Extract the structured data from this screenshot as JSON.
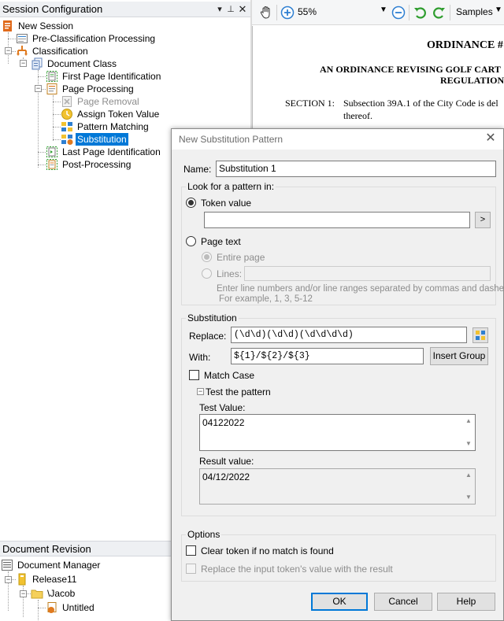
{
  "session_panel": {
    "title": "Session Configuration",
    "tree": [
      {
        "label": "New Session"
      },
      {
        "label": "Pre-Classification Processing"
      },
      {
        "label": "Classification"
      },
      {
        "label": "Document Class"
      },
      {
        "label": "First Page Identification"
      },
      {
        "label": "Page Processing"
      },
      {
        "label": "Page Removal",
        "disabled": true
      },
      {
        "label": "Assign Token Value"
      },
      {
        "label": "Pattern Matching"
      },
      {
        "label": "Substitution",
        "selected": true
      },
      {
        "label": "Last Page Identification"
      },
      {
        "label": "Post-Processing"
      }
    ]
  },
  "revision_panel": {
    "title": "Document Revision",
    "tree": [
      {
        "label": "Document Manager"
      },
      {
        "label": "Release11"
      },
      {
        "label": "\\Jacob"
      },
      {
        "label": "Untitled"
      }
    ]
  },
  "viewer": {
    "zoom": "55%",
    "samples_label": "Samples",
    "doc": {
      "heading": "ORDINANCE #",
      "subheading_1": "AN ORDINANCE REVISING GOLF CART",
      "subheading_2": "REGULATION",
      "section_label": "SECTION 1:",
      "section_text": "Subsection 39A.1 of the City Code is del",
      "section_text_2": "thereof."
    }
  },
  "dialog": {
    "title": "New Substitution Pattern",
    "name_label": "Name:",
    "name_value": "Substitution 1",
    "look_group_label": "Look for a pattern in:",
    "token_value_label": "Token value",
    "token_value": "",
    "browse_label": ">",
    "page_text_label": "Page text",
    "entire_page_label": "Entire page",
    "lines_label": "Lines:",
    "lines_value": "",
    "lines_help_1": "Enter line numbers and/or line ranges separated by commas and dashes.",
    "lines_help_2": "For example, 1, 3, 5-12",
    "substitution_group_label": "Substitution",
    "replace_label": "Replace:",
    "replace_value": "(\\d\\d)(\\d\\d)(\\d\\d\\d\\d)",
    "with_label": "With:",
    "with_value": "${1}/${2}/${3}",
    "insert_group_label": "Insert Group",
    "match_case_label": "Match Case",
    "test_pattern_label": "Test the pattern",
    "test_value_label": "Test Value:",
    "test_value": "04122022",
    "result_value_label": "Result value:",
    "result_value": "04/12/2022",
    "options_group_label": "Options",
    "clear_token_label": "Clear token if no match is found",
    "replace_input_label": "Replace the input token's value with the result",
    "ok_label": "OK",
    "cancel_label": "Cancel",
    "help_label": "Help"
  },
  "colors": {
    "selection": "#0078d7",
    "accent_green": "#2e9d2e",
    "icon_orange": "#e07a1f"
  }
}
